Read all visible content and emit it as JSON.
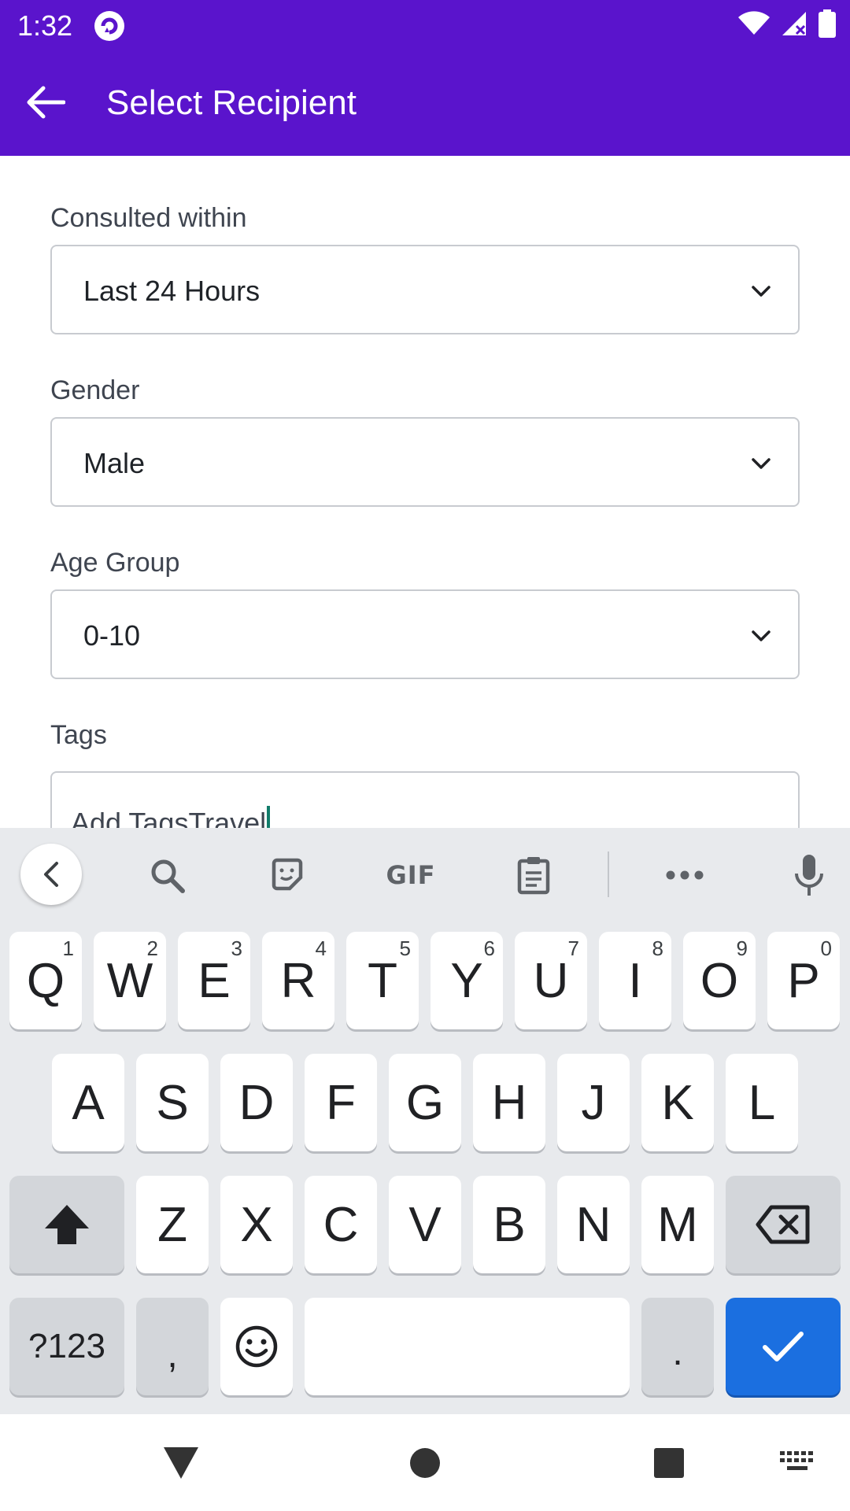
{
  "status_bar": {
    "time": "1:32",
    "color": "#5a14cc"
  },
  "app_bar": {
    "title": "Select Recipient",
    "back_icon": "arrow-back-icon"
  },
  "form": {
    "consulted": {
      "label": "Consulted within",
      "value": "Last 24 Hours"
    },
    "gender": {
      "label": "Gender",
      "value": "Male"
    },
    "age_group": {
      "label": "Age Group",
      "value": "0-10"
    },
    "tags": {
      "label": "Tags",
      "value": "Add TagsTravel"
    }
  },
  "keyboard": {
    "toolbar": {
      "gif_label": "GIF"
    },
    "row1": [
      {
        "key": "Q",
        "hint": "1"
      },
      {
        "key": "W",
        "hint": "2"
      },
      {
        "key": "E",
        "hint": "3"
      },
      {
        "key": "R",
        "hint": "4"
      },
      {
        "key": "T",
        "hint": "5"
      },
      {
        "key": "Y",
        "hint": "6"
      },
      {
        "key": "U",
        "hint": "7"
      },
      {
        "key": "I",
        "hint": "8"
      },
      {
        "key": "O",
        "hint": "9"
      },
      {
        "key": "P",
        "hint": "0"
      }
    ],
    "row2": [
      "A",
      "S",
      "D",
      "F",
      "G",
      "H",
      "J",
      "K",
      "L"
    ],
    "row3": [
      "Z",
      "X",
      "C",
      "V",
      "B",
      "N",
      "M"
    ],
    "symbols_label": "?123",
    "comma": ",",
    "period": ".",
    "accent_color": "#1b6fe0"
  }
}
